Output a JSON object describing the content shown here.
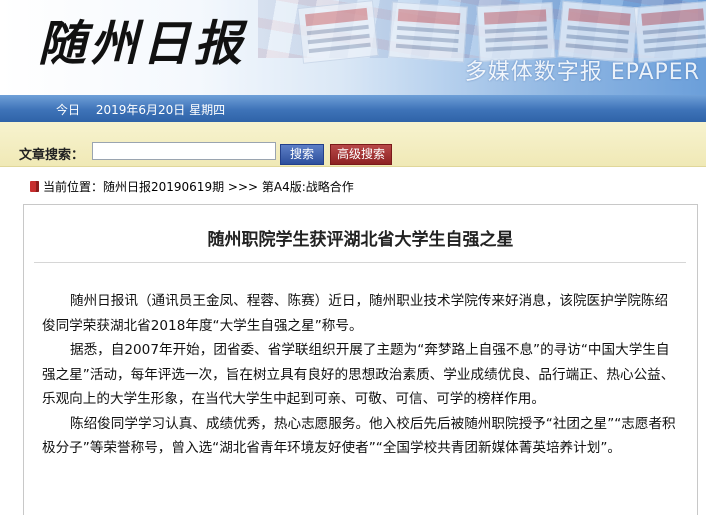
{
  "header": {
    "logo": "随州日报",
    "slogan": "多媒体数字报 EPAPER",
    "date_text": "今日　 2019年6月20日  星期四"
  },
  "search": {
    "label": "文章搜索：",
    "input_value": "",
    "search_button": "搜索",
    "advanced_button": "高级搜索"
  },
  "breadcrumb": {
    "text": "当前位置：随州日报20190619期  >>> 第A4版:战略合作"
  },
  "article": {
    "title": "随州职院学生获评湖北省大学生自强之星",
    "paragraphs": [
      "随州日报讯（通讯员王金凤、程蓉、陈赛）近日，随州职业技术学院传来好消息，该院医护学院陈绍俊同学荣获湖北省2018年度“大学生自强之星”称号。",
      "据悉，自2007年开始，团省委、省学联组织开展了主题为“奔梦路上自强不息”的寻访“中国大学生自强之星”活动，每年评选一次，旨在树立具有良好的思想政治素质、学业成绩优良、品行端正、热心公益、乐观向上的大学生形象，在当代大学生中起到可亲、可敬、可信、可学的榜样作用。",
      "陈绍俊同学学习认真、成绩优秀，热心志愿服务。他入校后先后被随州职院授予“社团之星”“志愿者积极分子”等荣誉称号，曾入选“湖北省青年环境友好使者”“全国学校共青团新媒体菁英培养计划”。"
    ]
  },
  "colors": {
    "date_bar": "#3e73b8",
    "search_bar": "#f0e9b6",
    "search_button": "#2d4f9c",
    "advanced_button": "#8e2222"
  }
}
